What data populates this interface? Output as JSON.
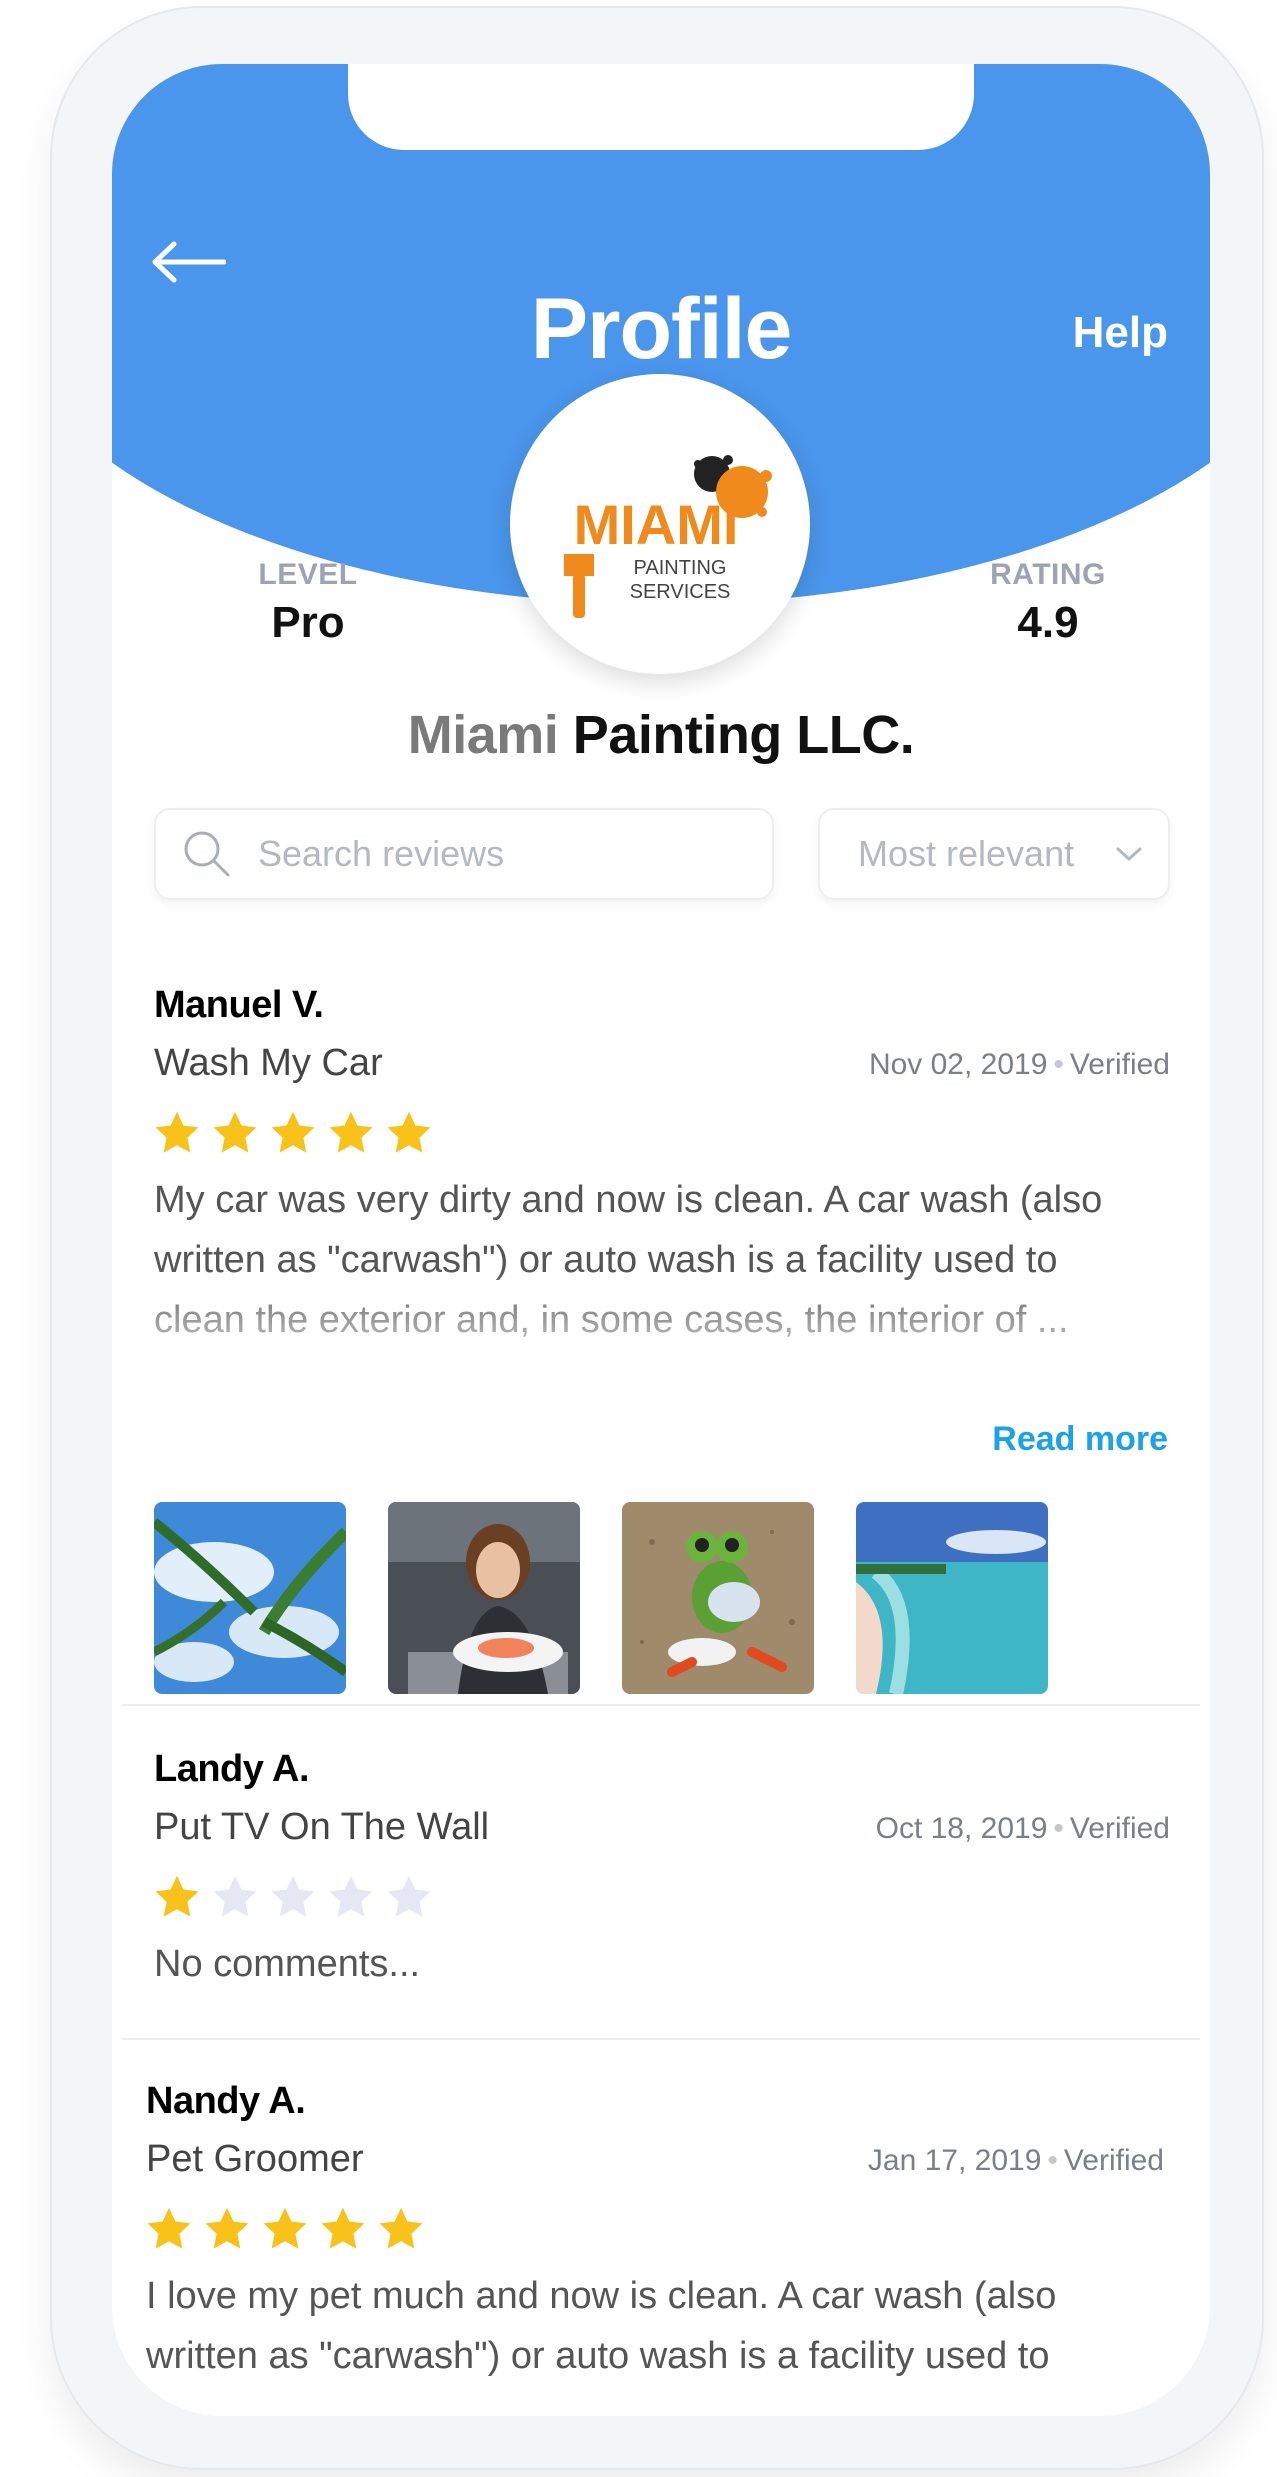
{
  "header": {
    "title": "Profile",
    "help_label": "Help",
    "accent_color": "#4a96ec"
  },
  "logo": {
    "line1": "MIAMI",
    "line2": "PAINTING",
    "line3": "SERVICES"
  },
  "stats": {
    "level_label": "LEVEL",
    "level_value": "Pro",
    "rating_label": "RATING",
    "rating_value": "4.9"
  },
  "business": {
    "name_first": "Miami",
    "name_rest": "Painting LLC."
  },
  "search": {
    "placeholder": "Search reviews",
    "value": ""
  },
  "sort": {
    "selected": "Most relevant"
  },
  "reviews": [
    {
      "reviewer": "Manuel V.",
      "service": "Wash My Car",
      "date": "Nov 02, 2019",
      "status": "Verified",
      "rating": 5,
      "body": "My car was very dirty and now is clean. A car wash (also written as \"carwash\") or auto wash is a facility used to clean the exterior and, in some cases, the interior of ...",
      "read_more_label": "Read more",
      "photos": [
        "palm-trees-sky-photo",
        "woman-with-salmon-plate-photo",
        "frog-figurine-photo",
        "tropical-beach-photo"
      ]
    },
    {
      "reviewer": "Landy A.",
      "service": "Put TV On The Wall",
      "date": "Oct 18, 2019",
      "status": "Verified",
      "rating": 1,
      "body": "No comments..."
    },
    {
      "reviewer": "Nandy A.",
      "service": "Pet Groomer",
      "date": "Jan 17, 2019",
      "status": "Verified",
      "rating": 5,
      "body": "I love my pet much and now is clean. A car wash (also written as \"carwash\") or auto wash is a facility used to"
    }
  ],
  "colors": {
    "star_filled": "#f8c21b",
    "star_empty": "#e6e7f4",
    "link": "#1da1e8"
  }
}
